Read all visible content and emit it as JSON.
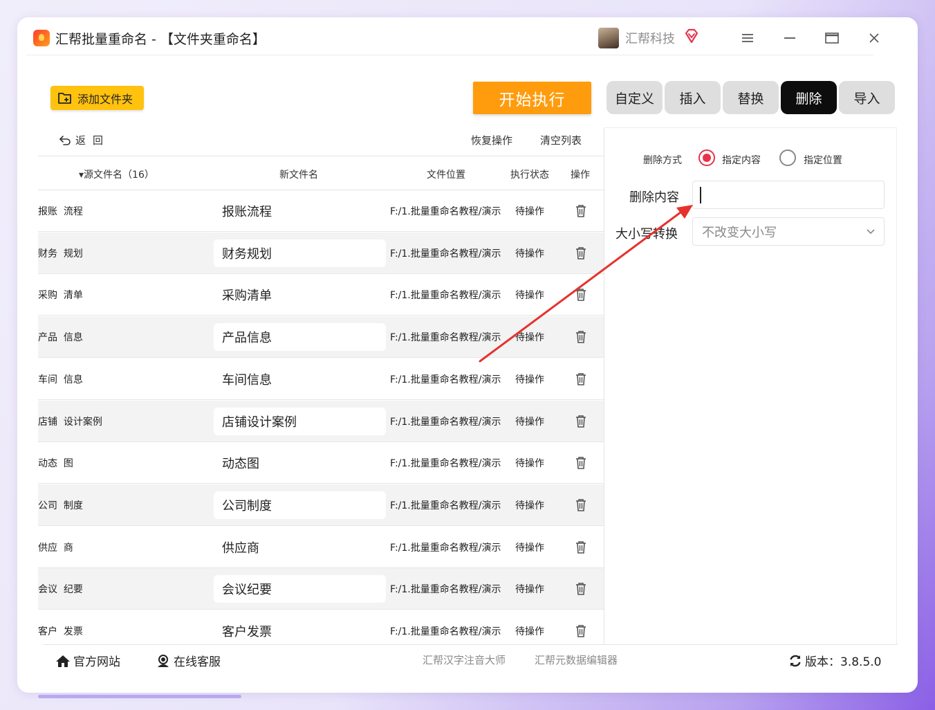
{
  "window": {
    "app_title": "汇帮批量重命名 - 【文件夹重命名】",
    "brand_name": "汇帮科技",
    "controls": {
      "menu": "≡",
      "minimize": "—",
      "maximize": "▭",
      "close": "✕"
    }
  },
  "toolbar": {
    "add_folder_label": "添加文件夹",
    "start_label": "开始执行",
    "tabs": [
      {
        "label": "自定义",
        "active": false
      },
      {
        "label": "插入",
        "active": false
      },
      {
        "label": "替换",
        "active": false
      },
      {
        "label": "删除",
        "active": true
      },
      {
        "label": "导入",
        "active": false
      }
    ]
  },
  "list": {
    "back_label": "返回",
    "restore_label": "恢复操作",
    "clear_label": "清空列表",
    "columns": {
      "source": "源文件名（16）",
      "new_name": "新文件名",
      "location": "文件位置",
      "status": "执行状态",
      "action": "操作"
    },
    "rows": [
      {
        "source": "报账  流程",
        "new_name": "报账流程",
        "path": "F:/1.批量重命名教程/演示",
        "status": "待操作"
      },
      {
        "source": "财务  规划",
        "new_name": "财务规划",
        "path": "F:/1.批量重命名教程/演示",
        "status": "待操作"
      },
      {
        "source": "采购  清单",
        "new_name": "采购清单",
        "path": "F:/1.批量重命名教程/演示",
        "status": "待操作"
      },
      {
        "source": "产品  信息",
        "new_name": "产品信息",
        "path": "F:/1.批量重命名教程/演示",
        "status": "待操作"
      },
      {
        "source": "车间  信息",
        "new_name": "车间信息",
        "path": "F:/1.批量重命名教程/演示",
        "status": "待操作"
      },
      {
        "source": "店铺  设计案例",
        "new_name": "店铺设计案例",
        "path": "F:/1.批量重命名教程/演示",
        "status": "待操作"
      },
      {
        "source": "动态  图",
        "new_name": "动态图",
        "path": "F:/1.批量重命名教程/演示",
        "status": "待操作"
      },
      {
        "source": "公司  制度",
        "new_name": "公司制度",
        "path": "F:/1.批量重命名教程/演示",
        "status": "待操作"
      },
      {
        "source": "供应  商",
        "new_name": "供应商",
        "path": "F:/1.批量重命名教程/演示",
        "status": "待操作"
      },
      {
        "source": "会议  纪要",
        "new_name": "会议纪要",
        "path": "F:/1.批量重命名教程/演示",
        "status": "待操作"
      },
      {
        "source": "客户  发票",
        "new_name": "客户发票",
        "path": "F:/1.批量重命名教程/演示",
        "status": "待操作"
      }
    ]
  },
  "settings": {
    "delete_mode_label": "删除方式",
    "mode_specified_content": "指定内容",
    "mode_specified_position": "指定位置",
    "selected_mode": "指定内容",
    "delete_content_label": "删除内容",
    "delete_content_value": "",
    "case_label": "大小写转换",
    "case_value": "不改变大小写"
  },
  "footer": {
    "website_label": "官方网站",
    "support_label": "在线客服",
    "link1": "汇帮汉字注音大师",
    "link2": "汇帮元数据编辑器",
    "version_label": "版本：3.8.5.0"
  },
  "colors": {
    "start_button": "#ff9c0d",
    "add_folder_button": "#ffc20e",
    "active_tab": "#0d0d0d",
    "radio_selected": "#e8334a",
    "annotation_arrow": "#e5322d"
  }
}
